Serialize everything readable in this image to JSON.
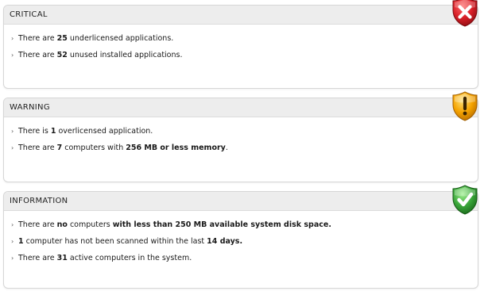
{
  "panels": {
    "critical": {
      "title": "CRITICAL",
      "icon": "error-shield-icon",
      "color": "#d0202a",
      "lines": [
        {
          "p1": "There are ",
          "b1": "25",
          "p2": " underlicensed applications.",
          "b2": "",
          "p3": ""
        },
        {
          "p1": "There are ",
          "b1": "52",
          "p2": " unused installed applications.",
          "b2": "",
          "p3": ""
        }
      ]
    },
    "warning": {
      "title": "WARNING",
      "icon": "warning-shield-icon",
      "color": "#f0a000",
      "lines": [
        {
          "p1": "There is ",
          "b1": "1",
          "p2": " overlicensed application.",
          "b2": "",
          "p3": ""
        },
        {
          "p1": "There are ",
          "b1": "7",
          "p2": " computers with ",
          "b2": "256 MB or less memory",
          "p3": "."
        }
      ]
    },
    "information": {
      "title": "INFORMATION",
      "icon": "check-shield-icon",
      "color": "#3aa23a",
      "lines": [
        {
          "p1": "There are ",
          "b1": "no",
          "p2": " computers ",
          "b2": "with less than 250 MB available system disk space.",
          "p3": ""
        },
        {
          "p1": "",
          "b1": "1",
          "p2": " computer has not been scanned within the last ",
          "b2": "14 days.",
          "p3": ""
        },
        {
          "p1": "There are ",
          "b1": "31",
          "p2": " active computers in the system.",
          "b2": "",
          "p3": ""
        }
      ]
    }
  }
}
